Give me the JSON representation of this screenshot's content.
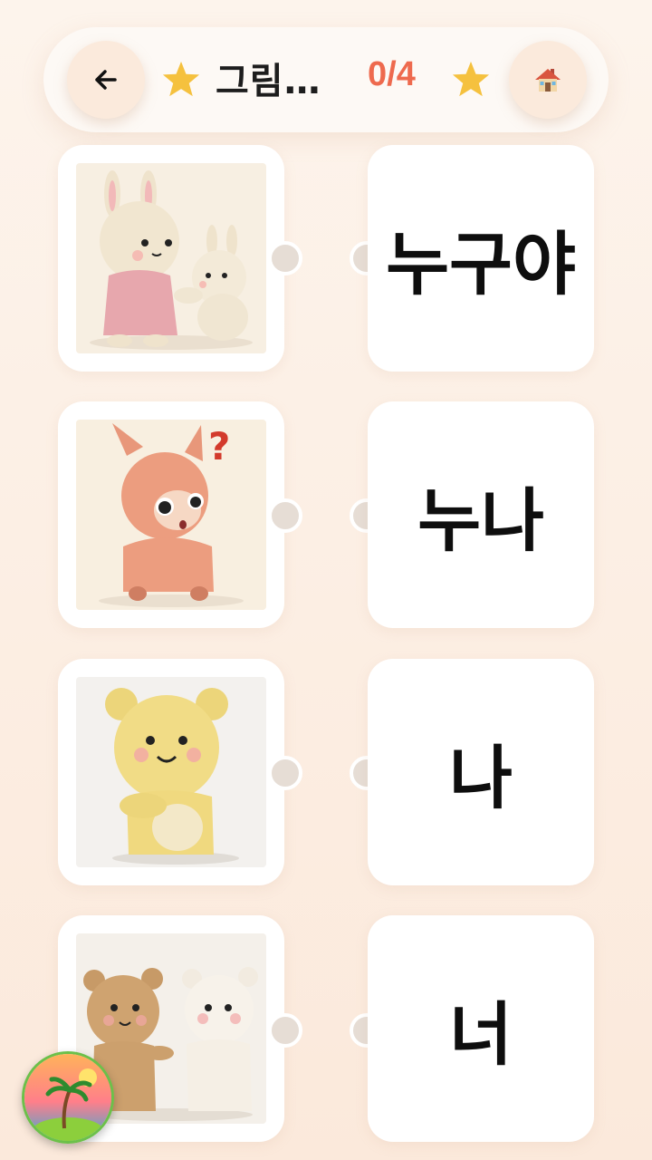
{
  "header": {
    "back_icon": "arrow-left-icon",
    "title": "그림…",
    "score": "0/4",
    "star_icon": "star-icon",
    "home_icon": "house-icon"
  },
  "pictures": [
    {
      "subject": "rabbit-mother-and-baby"
    },
    {
      "subject": "confused-deer"
    },
    {
      "subject": "yellow-bear-pointing-self"
    },
    {
      "subject": "bear-pointing-at-friend"
    }
  ],
  "words": [
    "누구야",
    "누나",
    "나",
    "너"
  ],
  "colors": {
    "accent": "#ee6a4e",
    "star": "#f5c13e",
    "background": "#fdf4ec"
  }
}
